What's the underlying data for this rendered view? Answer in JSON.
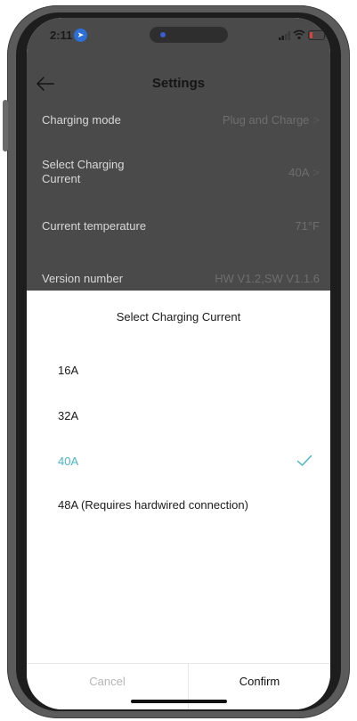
{
  "status_bar": {
    "time": "2:11"
  },
  "header": {
    "title": "Settings"
  },
  "settings": [
    {
      "label": "Charging mode",
      "value": "Plug and Charge",
      "chevron": ">"
    },
    {
      "label": "Select Charging Current",
      "value": "40A",
      "chevron": ">"
    },
    {
      "label": "Current temperature",
      "value": "71°F",
      "chevron": ""
    },
    {
      "label": "Version number",
      "value": "HW V1.2,SW V1.1.6",
      "chevron": ""
    }
  ],
  "sheet": {
    "title": "Select Charging Current",
    "options": [
      {
        "label": "16A",
        "selected": false
      },
      {
        "label": "32A",
        "selected": false
      },
      {
        "label": "40A",
        "selected": true
      },
      {
        "label": "48A (Requires hardwired connection)",
        "selected": false
      }
    ],
    "cancel_label": "Cancel",
    "confirm_label": "Confirm"
  },
  "colors": {
    "accent": "#4ab7c6",
    "overlay": "#4a4a4a",
    "frame": "#5b5b5b"
  },
  "icons": {
    "back": "arrow-left-icon",
    "check": "check-icon",
    "location": "location-arrow-icon",
    "signal": "signal-icon",
    "wifi": "wifi-icon",
    "battery": "battery-icon"
  }
}
